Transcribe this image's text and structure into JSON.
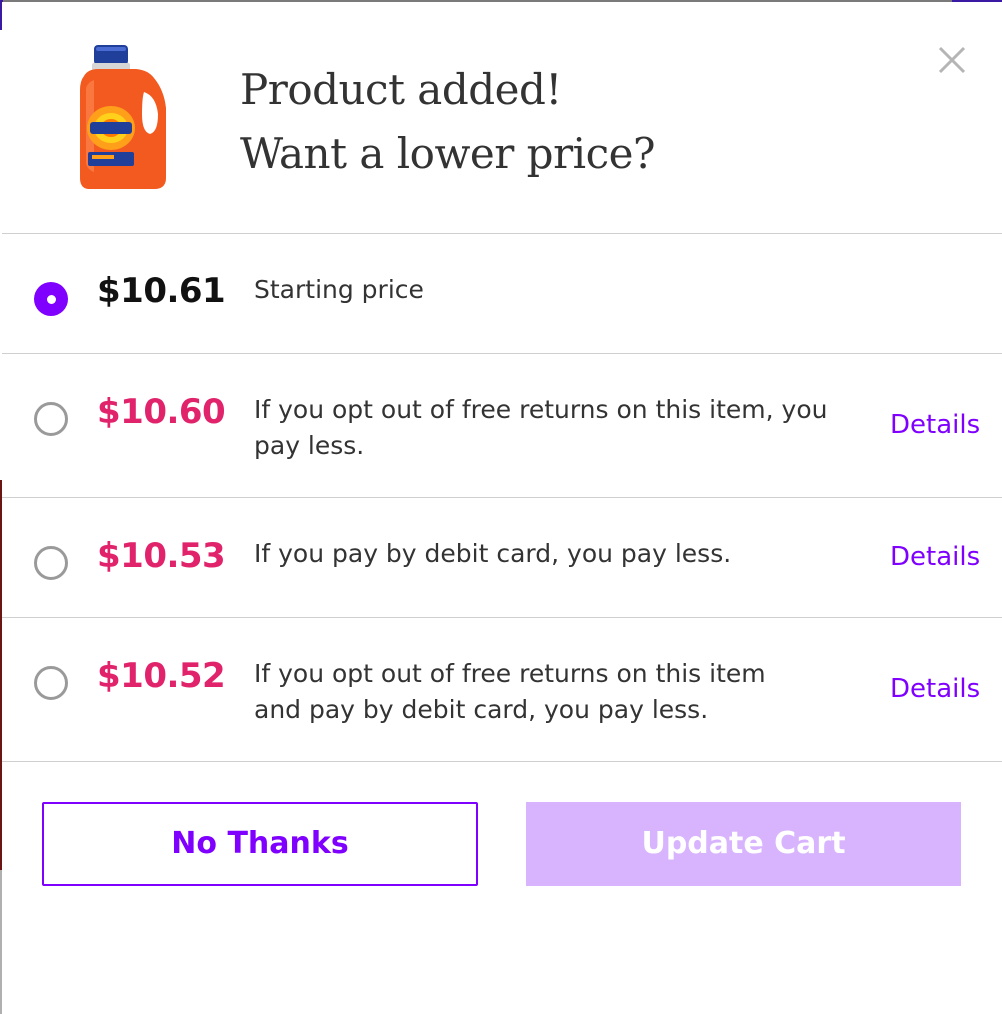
{
  "header": {
    "title_line1": "Product added!",
    "title_line2": "Want a lower price?",
    "product_brand": "Tide",
    "close_icon": "close-icon"
  },
  "options": [
    {
      "price": "$10.61",
      "description": "Starting price",
      "selected": true,
      "details_label": ""
    },
    {
      "price": "$10.60",
      "description": "If you opt out of free returns on this item, you pay less.",
      "selected": false,
      "details_label": "Details"
    },
    {
      "price": "$10.53",
      "description": "If you pay by debit card, you pay less.",
      "selected": false,
      "details_label": "Details"
    },
    {
      "price": "$10.52",
      "description": "If you opt out of free returns on this item and pay by debit card, you pay less.",
      "selected": false,
      "details_label": "Details"
    }
  ],
  "actions": {
    "no_thanks_label": "No Thanks",
    "update_cart_label": "Update Cart"
  },
  "colors": {
    "accent": "#8000ff",
    "sale_price": "#e0236b",
    "update_button_disabled": "#d8b4fe"
  }
}
